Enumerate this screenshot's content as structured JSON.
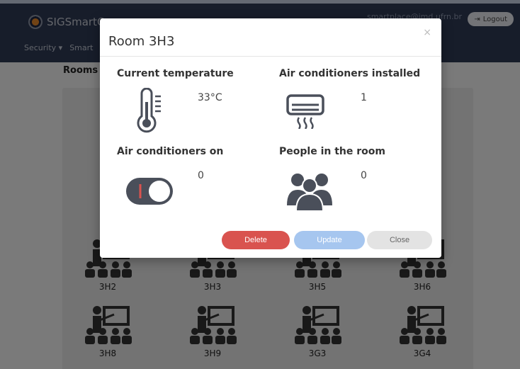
{
  "app": {
    "brand": "SIGSmartCampus",
    "user_email": "smartplace@imd.ufrn.br",
    "logout_label": "Logout"
  },
  "nav": {
    "items": [
      "Security ▾",
      "Smart"
    ]
  },
  "page": {
    "title": "Rooms"
  },
  "rooms": [
    {
      "label": "3H2"
    },
    {
      "label": "3H3"
    },
    {
      "label": "3H5"
    },
    {
      "label": "3H6"
    },
    {
      "label": "3H8"
    },
    {
      "label": "3H9"
    },
    {
      "label": "3G3"
    },
    {
      "label": "3G4"
    }
  ],
  "modal": {
    "title": "Room 3H3",
    "close_glyph": "×",
    "current_temperature": {
      "label": "Current temperature",
      "value": "33°C",
      "icon": "thermometer-icon"
    },
    "ac_installed": {
      "label": "Air conditioners installed",
      "value": "1",
      "icon": "air-conditioner-icon"
    },
    "ac_on": {
      "label": "Air conditioners on",
      "value": "0",
      "icon": "toggle-icon"
    },
    "people": {
      "label": "People in the room",
      "value": "0",
      "icon": "people-icon"
    },
    "buttons": {
      "delete": "Delete",
      "update": "Update",
      "close": "Close"
    }
  },
  "colors": {
    "header_bg": "#2f3b55",
    "delete": "#d9534f",
    "update": "#a6c6ef",
    "close": "#e3e3e3",
    "icon": "#4a4f5a"
  }
}
